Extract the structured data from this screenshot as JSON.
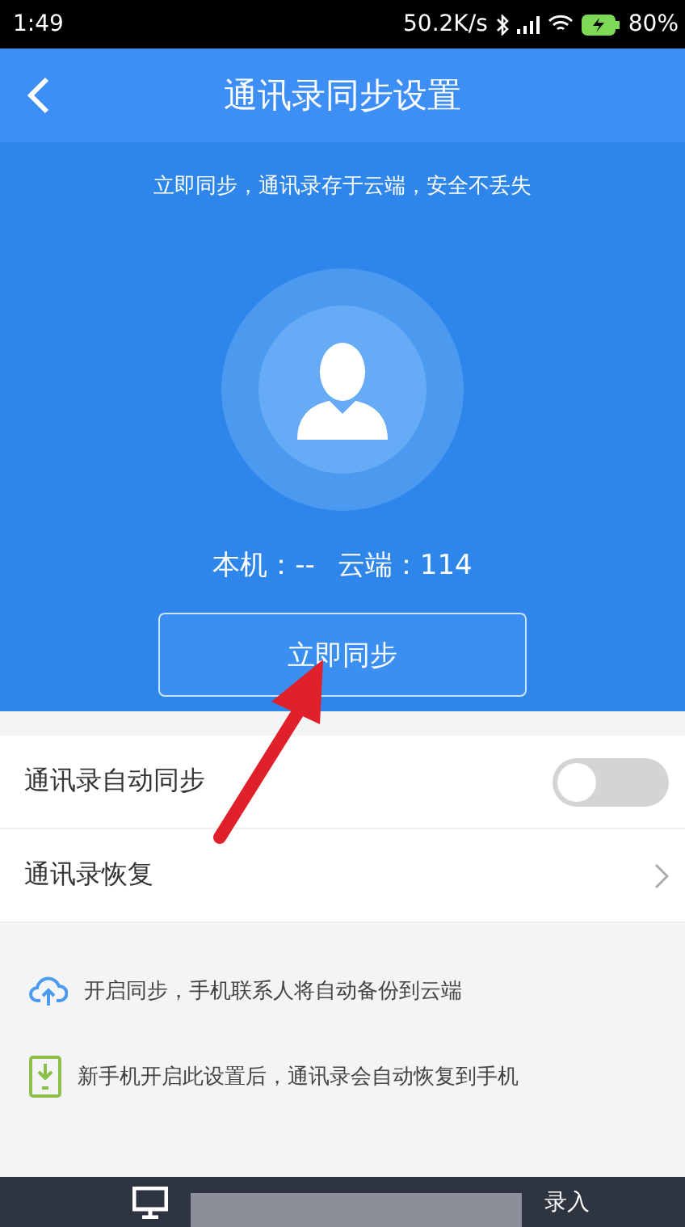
{
  "status_bar": {
    "time": "1:49",
    "network_speed": "50.2K/s",
    "battery": "80%"
  },
  "header": {
    "title": "通讯录同步设置"
  },
  "hero": {
    "subtitle": "立即同步，通讯录存于云端，安全不丢失",
    "local_count": "本机：--",
    "cloud_count": "云端：114",
    "button": "立即同步"
  },
  "settings": [
    {
      "kind": "toggle",
      "label": "通讯录自动同步",
      "on": false
    },
    {
      "kind": "link",
      "label": "通讯录恢复"
    }
  ],
  "tips": [
    {
      "kind": "cloud",
      "text": "开启同步，手机联系人将自动备份到云端"
    },
    {
      "kind": "download",
      "text": "新手机开启此设置后，通讯录会自动恢复到手机"
    }
  ],
  "bottom_bar": {
    "label": "录入"
  }
}
